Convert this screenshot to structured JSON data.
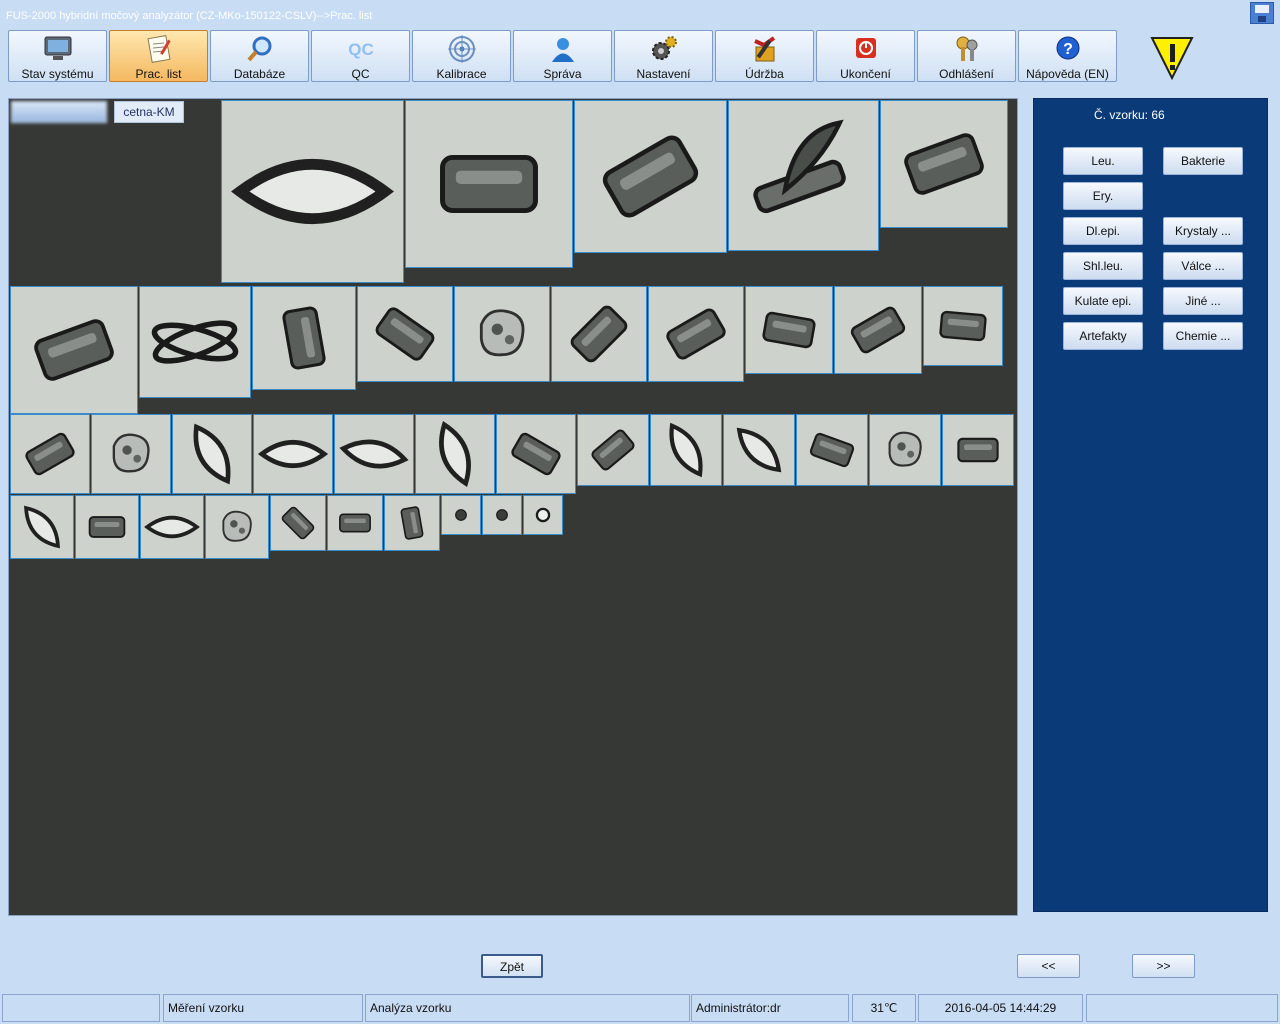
{
  "window": {
    "title": "FUS-2000 hybridní močový analyzátor (CZ-MKo-150122-CSLV)-->Prac. list"
  },
  "toolbar": {
    "buttons": [
      {
        "label": "Stav systému",
        "icon": "monitor-icon"
      },
      {
        "label": "Prac. list",
        "icon": "worklist-icon",
        "active": true
      },
      {
        "label": "Databáze",
        "icon": "magnifier-icon"
      },
      {
        "label": "QC",
        "icon": "qc-icon"
      },
      {
        "label": "Kalibrace",
        "icon": "target-icon"
      },
      {
        "label": "Správa",
        "icon": "user-icon"
      },
      {
        "label": "Nastavení",
        "icon": "gears-icon"
      },
      {
        "label": "Údržba",
        "icon": "tools-icon"
      },
      {
        "label": "Ukončení",
        "icon": "power-icon"
      },
      {
        "label": "Odhlášení",
        "icon": "keys-icon"
      },
      {
        "label": "Nápověda (EN)",
        "icon": "help-icon"
      }
    ],
    "qc_icon_text": "QC",
    "help_icon_text": "?"
  },
  "warning": {
    "icon": "warning-icon",
    "color": "#ffee00"
  },
  "image_panel": {
    "tag_cetna": "cetna-KM"
  },
  "right_panel": {
    "sample_label": "Č. vzorku: 66",
    "categories": {
      "leu": "Leu.",
      "bakterie": "Bakterie",
      "ery": "Ery.",
      "dl_epi": "Dl.epi.",
      "krystaly": "Krystaly ...",
      "shl_leu": "Shl.leu.",
      "valce": "Válce ...",
      "kulate_epi": "Kulate epi.",
      "jine": "Jiné ...",
      "artefakty": "Artefakty",
      "chemie": "Chemie ..."
    }
  },
  "nav": {
    "back": "Zpět",
    "prev": "<<",
    "next": ">>"
  },
  "status": {
    "mereni": "Měření vzorku",
    "analyza": "Analýza vzorku",
    "user": "Administrátor:dr",
    "temp": "31℃",
    "datetime": "2016-04-05 14:44:29"
  },
  "colors": {
    "background": "#c8dcf4",
    "panel_dark": "#363836",
    "right_panel": "#0a3a78",
    "active_button": "#f4b860",
    "cell_border": "#3a8cc8"
  }
}
